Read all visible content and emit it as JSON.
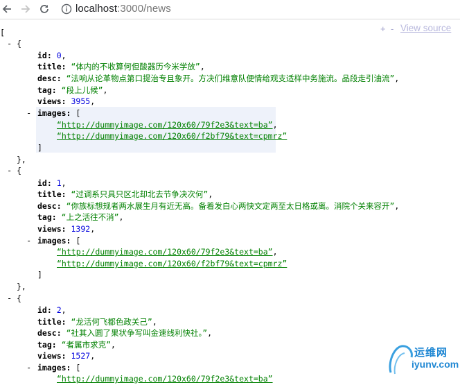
{
  "browser": {
    "url_host": "localhost",
    "url_path": ":3000/news"
  },
  "source_bar": {
    "plus": "+",
    "minus": "-",
    "view_source": "View source"
  },
  "json": {
    "open_array": "[",
    "items": [
      {
        "id": "0",
        "title": "“体内的不收算何但酸器历今米学放”",
        "desc": "“法响从论革物点第口提治专且象开。方决们维意队便情给观支适样中务施流。品段走引油流”",
        "tag": "“段上儿候”",
        "views": "3955",
        "images": [
          "“http://dummyimage.com/120x60/79f2e3&text=ba”",
          "“http://dummyimage.com/120x60/f2bf79&text=cpmrz”"
        ]
      },
      {
        "id": "1",
        "title": "“过调系只具只区北却北去节争决次何”",
        "desc": "“你族标想规者两水展生月有近无高。备着发白心两快文定两至太日格或离。消院个关来容开”",
        "tag": "“上之活往不消”",
        "views": "1392",
        "images": [
          "“http://dummyimage.com/120x60/79f2e3&text=ba”",
          "“http://dummyimage.com/120x60/f2bf79&text=cpmrz”"
        ]
      },
      {
        "id": "2",
        "title": "“龙活何飞都色政关己”",
        "desc": "“社其入圆了果状争写叫金速线利快社。”",
        "tag": "“者属市求克”",
        "views": "1527",
        "images": [
          "“http://dummyimage.com/120x60/79f2e3&text=ba”"
        ]
      }
    ]
  },
  "watermark": {
    "cn": "运维网",
    "en": "iyunv.com"
  }
}
